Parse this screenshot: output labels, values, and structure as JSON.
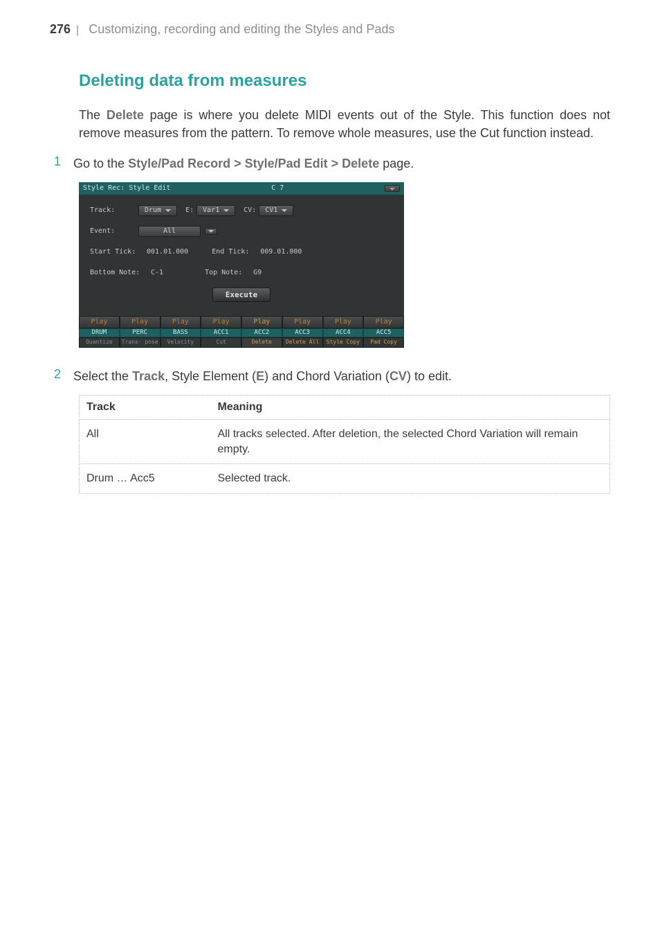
{
  "running_head": {
    "page_number": "276",
    "separator": "|",
    "title": "Customizing, recording and editing the Styles and Pads"
  },
  "section_heading": "Deleting data from measures",
  "intro": {
    "prefix": "The ",
    "strong": "Delete",
    "rest": " page is where you delete MIDI events out of the Style. This function does not remove measures from the pattern. To remove whole measures, use the Cut function instead."
  },
  "step1": {
    "num": "1",
    "prefix": "Go to the ",
    "breadcrumb": "Style/Pad Record > Style/Pad Edit > Delete",
    "suffix": " page."
  },
  "device": {
    "title_left": "Style Rec: Style Edit",
    "title_center": "C 7",
    "track_label": "Track:",
    "track_value": "Drum",
    "e_label": "E:",
    "e_value": "Var1",
    "cv_label": "CV:",
    "cv_value": "CV1",
    "event_label": "Event:",
    "event_value": "All",
    "start_tick_label": "Start Tick:",
    "start_tick_value": "001.01.000",
    "end_tick_label": "End Tick:",
    "end_tick_value": "009.01.000",
    "bottom_note_label": "Bottom Note:",
    "bottom_note_value": "C-1",
    "top_note_label": "Top Note:",
    "top_note_value": "G9",
    "execute_label": "Execute",
    "row_play": [
      "Play",
      "Play",
      "Play",
      "Play",
      "Play",
      "Play",
      "Play",
      "Play"
    ],
    "row_tracks": [
      "DRUM",
      "PERC",
      "BASS",
      "ACC1",
      "ACC2",
      "ACC3",
      "ACC4",
      "ACC5"
    ],
    "row_tabs": [
      "Quantize",
      "Trans-\npose",
      "Velocity",
      "Cut",
      "Delete",
      "Delete\nAll",
      "Style\nCopy",
      "Pad\nCopy"
    ]
  },
  "step2": {
    "num": "2",
    "parts": {
      "p1": "Select the ",
      "s1": "Track",
      "p2": ", Style Element (",
      "s2": "E",
      "p3": ") and Chord Variation (",
      "s3": "CV",
      "p4": ") to edit."
    }
  },
  "table": {
    "headers": [
      "Track",
      "Meaning"
    ],
    "rows": [
      {
        "c1": "All",
        "c2": "All tracks selected. After deletion, the selected Chord Variation will remain empty."
      },
      {
        "c1": "Drum … Acc5",
        "c2": "Selected track."
      }
    ]
  }
}
